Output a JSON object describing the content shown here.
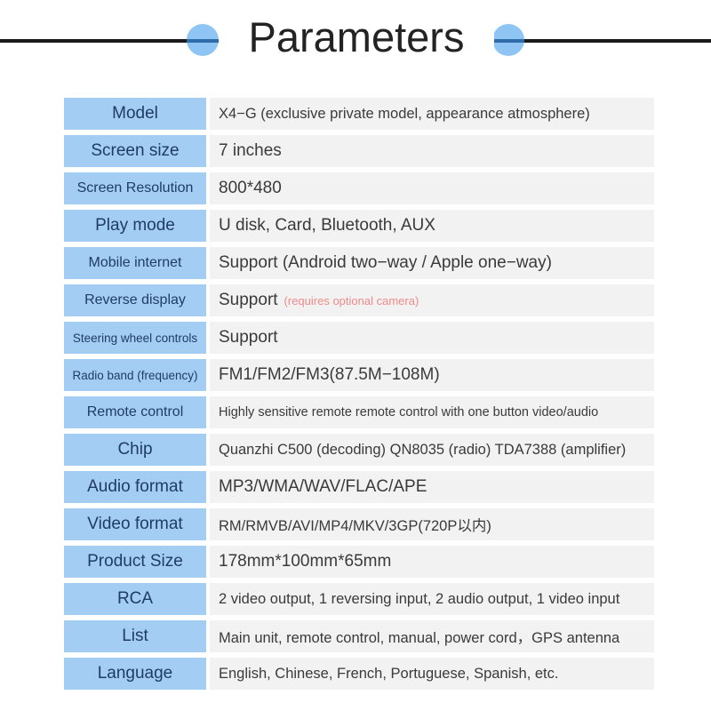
{
  "header": {
    "title": "Parameters",
    "accent_dot_color": "#8ec5f5",
    "rule_color": "#1a1a1a"
  },
  "table": {
    "label_bg": "#a4cdf4",
    "value_bg": "#f2f2f2",
    "label_text_color": "#1f3c64",
    "value_text_color": "#3a3a3a",
    "note_color": "#ef8a8a",
    "rows": [
      {
        "label": "Model",
        "label_size": "lg",
        "value": "X4−G (exclusive private model, appearance atmosphere)",
        "value_size": "md"
      },
      {
        "label": "Screen size",
        "label_size": "lg",
        "value": "7 inches",
        "value_size": "lg"
      },
      {
        "label": "Screen Resolution",
        "label_size": "md",
        "value": "800*480",
        "value_size": "lg"
      },
      {
        "label": "Play mode",
        "label_size": "lg",
        "value": "U disk, Card, Bluetooth, AUX",
        "value_size": "lg"
      },
      {
        "label": "Mobile internet",
        "label_size": "md",
        "value": "Support (Android two−way / Apple one−way)",
        "value_size": "lg"
      },
      {
        "label": "Reverse display",
        "label_size": "md",
        "value": "Support",
        "value_size": "lg",
        "note": "(requires optional camera)"
      },
      {
        "label": "Steering wheel controls",
        "label_size": "sm",
        "value": "Support",
        "value_size": "lg"
      },
      {
        "label": "Radio band (frequency)",
        "label_size": "sm",
        "value": "FM1/FM2/FM3(87.5M−108M)",
        "value_size": "lg"
      },
      {
        "label": "Remote control",
        "label_size": "md",
        "value": "Highly sensitive remote remote control with one button video/audio",
        "value_size": "sm"
      },
      {
        "label": "Chip",
        "label_size": "lg",
        "value": "Quanzhi C500 (decoding) QN8035 (radio) TDA7388 (amplifier)",
        "value_size": "md"
      },
      {
        "label": "Audio format",
        "label_size": "lg",
        "value": "MP3/WMA/WAV/FLAC/APE",
        "value_size": "lg"
      },
      {
        "label": "Video format",
        "label_size": "lg",
        "value": "RM/RMVB/AVI/MP4/MKV/3GP(720P以内)",
        "value_size": "md"
      },
      {
        "label": "Product Size",
        "label_size": "lg",
        "value": "178mm*100mm*65mm",
        "value_size": "lg"
      },
      {
        "label": "RCA",
        "label_size": "lg",
        "value": "2 video output, 1 reversing input, 2 audio output, 1 video input",
        "value_size": "md"
      },
      {
        "label": "List",
        "label_size": "lg",
        "value": "Main unit, remote control, manual, power cord，GPS antenna",
        "value_size": "md"
      },
      {
        "label": "Language",
        "label_size": "lg",
        "value": "English, Chinese, French, Portuguese, Spanish, etc.",
        "value_size": "md"
      }
    ]
  }
}
